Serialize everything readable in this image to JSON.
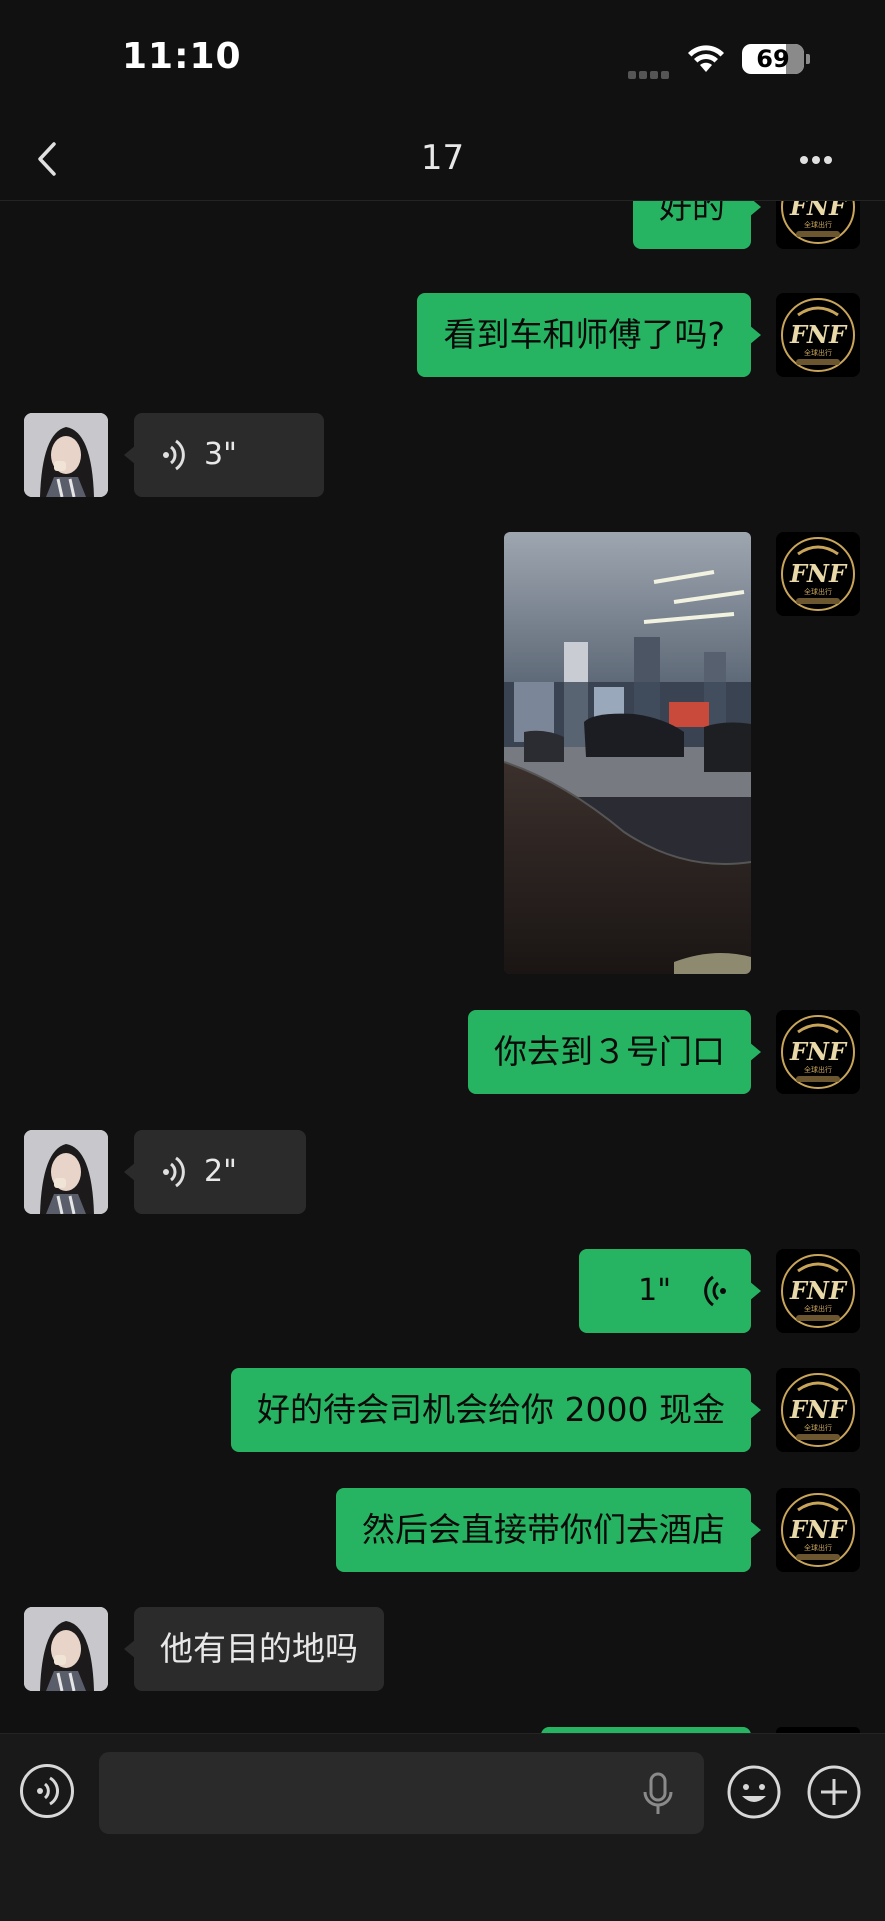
{
  "status_bar": {
    "time": "11:10",
    "battery": "69"
  },
  "nav": {
    "title": "17"
  },
  "messages": [
    {
      "type": "text",
      "side": "sent",
      "text": "好的"
    },
    {
      "type": "text",
      "side": "sent",
      "text": "看到车和师傅了吗?"
    },
    {
      "type": "voice",
      "side": "received",
      "duration": "3\""
    },
    {
      "type": "image",
      "side": "sent",
      "description_icon": "photo-parking-area"
    },
    {
      "type": "text",
      "side": "sent",
      "text": "你去到３号门口"
    },
    {
      "type": "voice",
      "side": "received",
      "duration": "2\""
    },
    {
      "type": "voice",
      "side": "sent",
      "duration": "1\""
    },
    {
      "type": "text",
      "side": "sent",
      "text": "好的待会司机会给你 2000 现金"
    },
    {
      "type": "text",
      "side": "sent",
      "text": "然后会直接带你们去酒店"
    },
    {
      "type": "text",
      "side": "received",
      "text": "他有目的地吗"
    }
  ],
  "avatars": {
    "self_logo_text": "FNF",
    "self_logo_subtext": "全球出行"
  },
  "input_bar": {
    "placeholder": ""
  },
  "colors": {
    "background": "#111111",
    "sent_bubble": "#27b462",
    "received_bubble": "#2b2b2b",
    "logo_gold": "#c9a55a"
  }
}
